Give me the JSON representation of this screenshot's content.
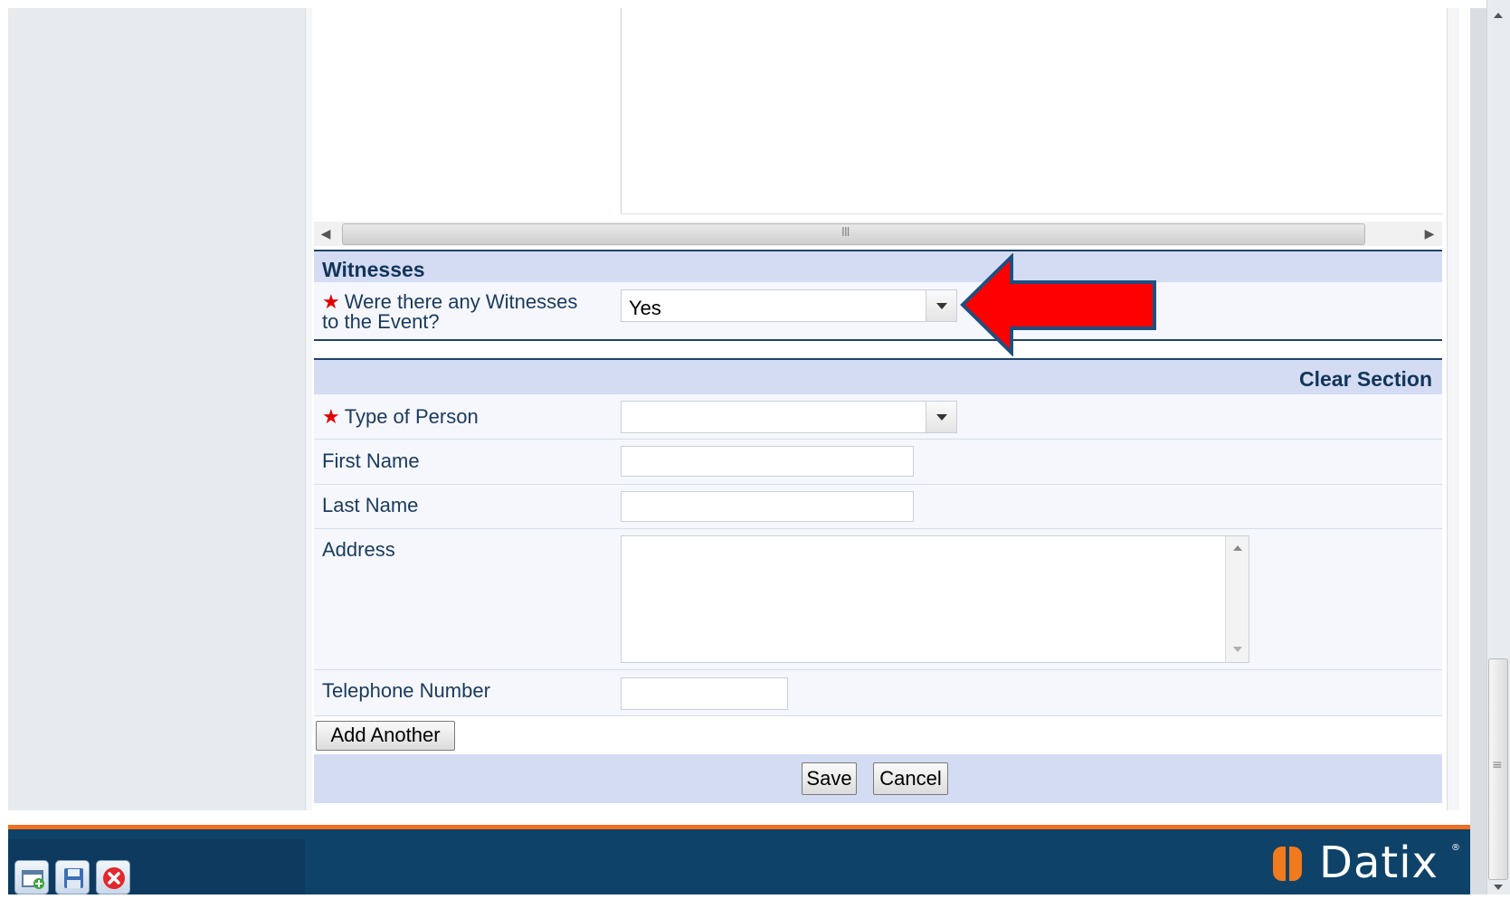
{
  "witnesses_section": {
    "title": "Witnesses",
    "question_label": "Were there any Witnesses to the Event?",
    "question_value": "Yes"
  },
  "person_section": {
    "clear_label": "Clear Section",
    "type_of_person_label": "Type of Person",
    "type_of_person_value": "",
    "first_name_label": "First Name",
    "last_name_label": "Last Name",
    "address_label": "Address",
    "telephone_label": "Telephone Number"
  },
  "required_marker": "★",
  "actions": {
    "add_another": "Add Another",
    "save": "Save",
    "cancel": "Cancel"
  },
  "hscroll_grip": "III",
  "brand": {
    "name": "Datix",
    "registered": "®",
    "accent_color": "#f07a1c",
    "footer_color": "#0f4269"
  },
  "annotation": {
    "arrow_color": "#ff0000",
    "arrow_outline": "#1f4f7f"
  },
  "toolbar_icons": [
    "new-record-icon",
    "save-disk-icon",
    "close-icon"
  ]
}
